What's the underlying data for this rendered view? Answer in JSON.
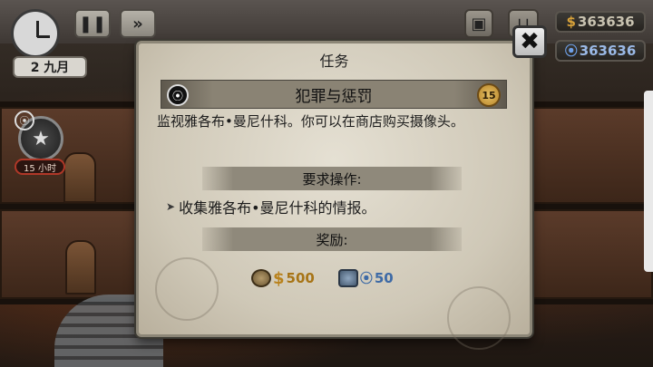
{
  "hud": {
    "date": "2 九月",
    "pause_icon": "pause-icon",
    "fast_forward_icon": "fast-forward-icon",
    "money": "363636",
    "money_symbol": "$",
    "reputation": "363636",
    "reputation_symbol": "⦿"
  },
  "left_panel": {
    "timer": "15 小时"
  },
  "dialog": {
    "title": "任务",
    "quest_name": "犯罪与惩罚",
    "level": "15",
    "description": "监视雅各布•曼尼什科。你可以在商店购买摄像头。",
    "requirements_heading": "要求操作:",
    "requirement_item": "收集雅各布•曼尼什科的情报。",
    "rewards_heading": "奖励:",
    "reward_cash_symbol": "$",
    "reward_cash": "500",
    "reward_rep_symbol": "⦿",
    "reward_rep": "50",
    "close_label": "✖"
  },
  "colors": {
    "dialog_bg": "#d8d2c3",
    "cash": "#a77416",
    "reputation": "#3d6aa6",
    "timer_border": "#b03828"
  }
}
